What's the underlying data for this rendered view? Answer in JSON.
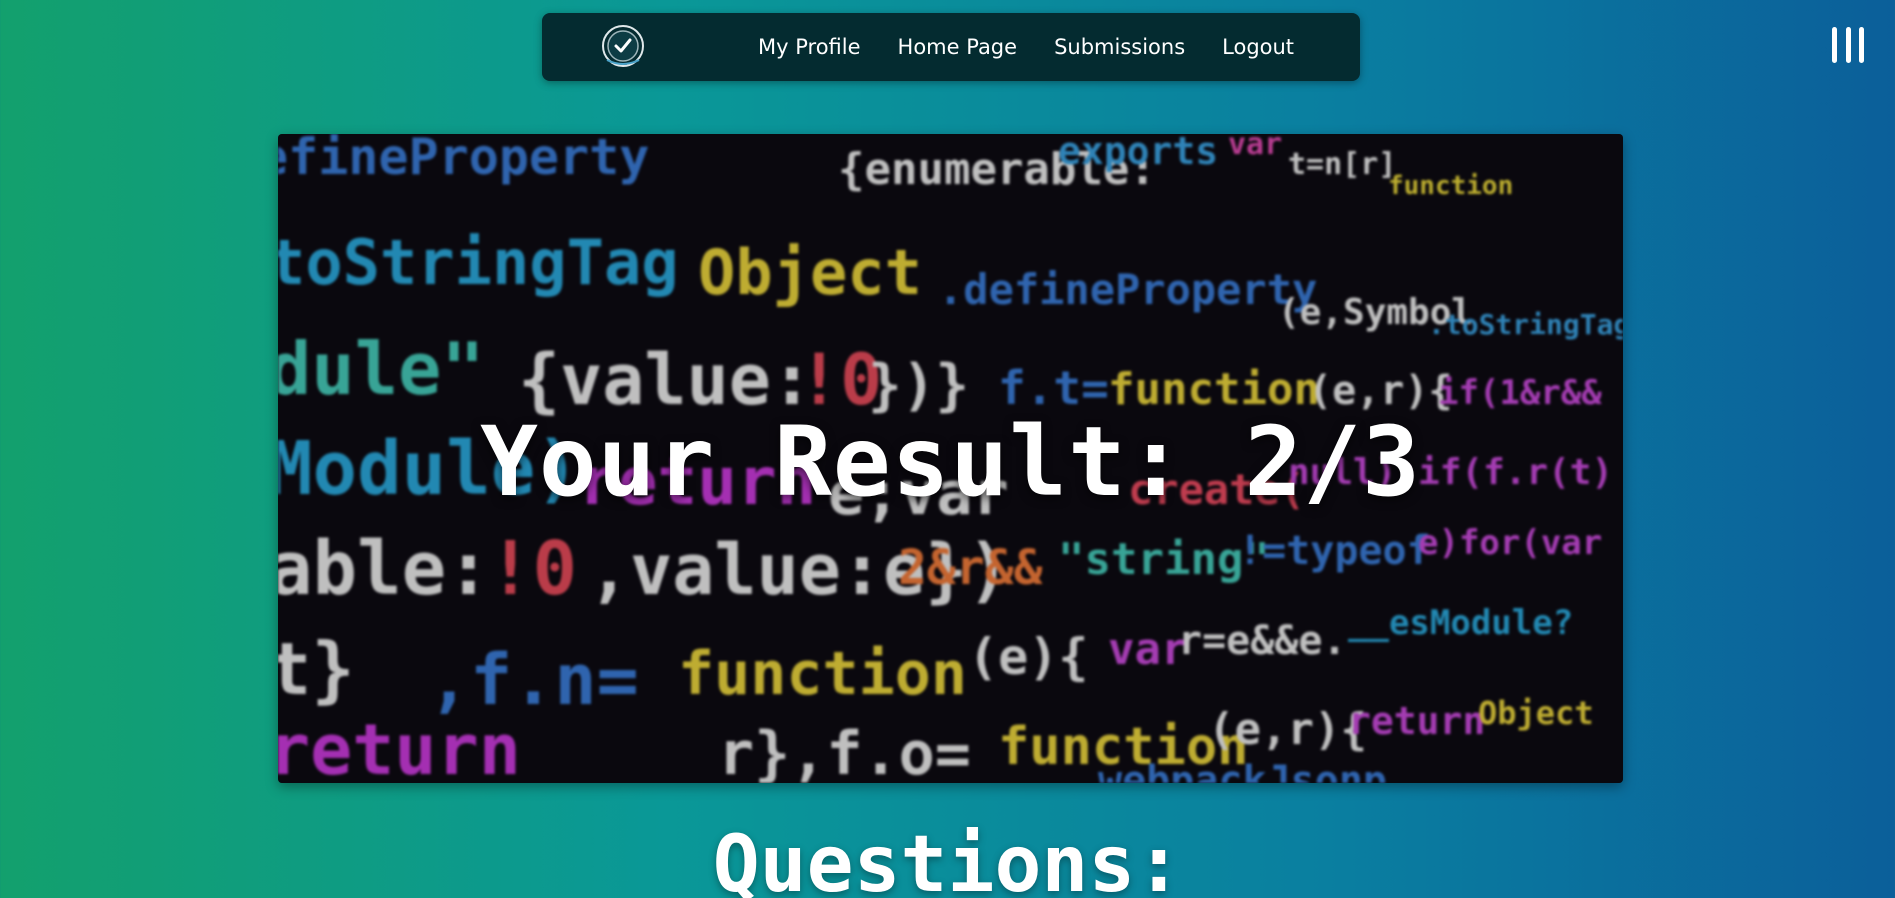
{
  "nav": {
    "logo_icon": "check-badge-icon",
    "links": [
      "My Profile",
      "Home Page",
      "Submissions",
      "Logout"
    ]
  },
  "menu": {
    "icon": "hamburger-menu-icon"
  },
  "hero": {
    "title": "Your Result: 2/3"
  },
  "questions": {
    "heading": "Questions:"
  },
  "colors": {
    "nav_bg": "#042b30",
    "gradient_start": "#13a06d",
    "gradient_end": "#0b5f9a"
  }
}
